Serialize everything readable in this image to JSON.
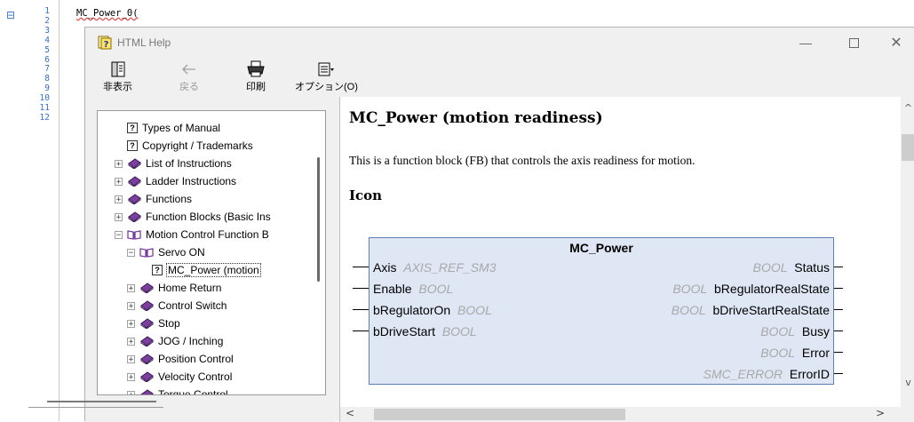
{
  "editor": {
    "fold_symbol": "⊟",
    "line_numbers": [
      "1",
      "2",
      "3",
      "4",
      "5",
      "6",
      "7",
      "8",
      "9",
      "10",
      "11",
      "12"
    ],
    "code_text": "MC_Power_0("
  },
  "window": {
    "title": "HTML Help",
    "minimize": "—",
    "close": "✕"
  },
  "toolbar": {
    "hide_label": "非表示",
    "back_label": "戻る",
    "print_label": "印刷",
    "options_label": "オプション(O)"
  },
  "nav": {
    "items": [
      {
        "label": "Types of Manual",
        "icon": "topic-icon",
        "expander": ""
      },
      {
        "label": "Copyright / Trademarks",
        "icon": "topic-icon",
        "expander": ""
      },
      {
        "label": "List of Instructions",
        "icon": "book-icon",
        "expander": "+"
      },
      {
        "label": "Ladder Instructions",
        "icon": "book-icon",
        "expander": "+"
      },
      {
        "label": "Functions",
        "icon": "book-icon",
        "expander": "+"
      },
      {
        "label": "Function Blocks (Basic Ins",
        "icon": "book-icon",
        "expander": "+"
      },
      {
        "label": "Motion Control Function B",
        "icon": "open-book-icon",
        "expander": "−"
      },
      {
        "label": "Servo ON",
        "icon": "open-book-icon",
        "expander": "−"
      },
      {
        "label": "MC_Power (motion",
        "icon": "topic-icon",
        "expander": ""
      },
      {
        "label": "Home Return",
        "icon": "book-icon",
        "expander": "+"
      },
      {
        "label": "Control Switch",
        "icon": "book-icon",
        "expander": "+"
      },
      {
        "label": "Stop",
        "icon": "book-icon",
        "expander": "+"
      },
      {
        "label": "JOG / Inching",
        "icon": "book-icon",
        "expander": "+"
      },
      {
        "label": "Position Control",
        "icon": "book-icon",
        "expander": "+"
      },
      {
        "label": "Velocity Control",
        "icon": "book-icon",
        "expander": "+"
      },
      {
        "label": "Torque Control",
        "icon": "book-icon",
        "expander": "+"
      }
    ]
  },
  "content": {
    "title": "MC_Power (motion readiness)",
    "description": "This is a function block (FB) that controls the axis readiness for motion.",
    "icon_heading": "Icon",
    "fb": {
      "name": "MC_Power",
      "inputs": [
        {
          "name": "Axis",
          "type": "AXIS_REF_SM3"
        },
        {
          "name": "Enable",
          "type": "BOOL"
        },
        {
          "name": "bRegulatorOn",
          "type": "BOOL"
        },
        {
          "name": "bDriveStart",
          "type": "BOOL"
        }
      ],
      "outputs": [
        {
          "name": "Status",
          "type": "BOOL"
        },
        {
          "name": "bRegulatorRealState",
          "type": "BOOL"
        },
        {
          "name": "bDriveStartRealState",
          "type": "BOOL"
        },
        {
          "name": "Busy",
          "type": "BOOL"
        },
        {
          "name": "Error",
          "type": "BOOL"
        },
        {
          "name": "ErrorID",
          "type": "SMC_ERROR"
        }
      ]
    }
  },
  "colors": {
    "fb_fill": "#dfe7f5",
    "fb_border": "#5c7fb5",
    "book": "#7b3fa0",
    "line_numbers": "#2f6fd0"
  }
}
